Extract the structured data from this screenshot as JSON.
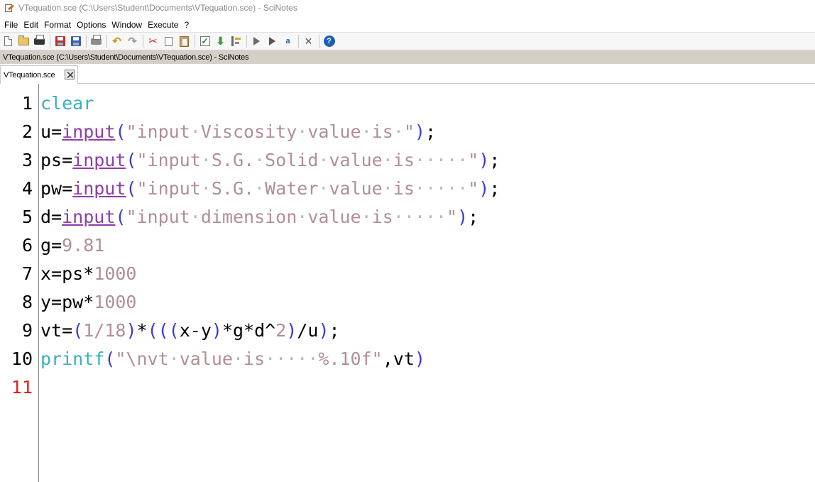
{
  "window": {
    "title": "VTequation.sce (C:\\Users\\Student\\Documents\\VTequation.sce) - SciNotes"
  },
  "menu": {
    "items": [
      "File",
      "Edit",
      "Format",
      "Options",
      "Window",
      "Execute",
      "?"
    ]
  },
  "toolbar": {
    "icons": [
      "new-file-icon",
      "open-folder-icon",
      "open-file-icon",
      "save-icon",
      "save-as-icon",
      "print-icon",
      "undo-icon",
      "redo-icon",
      "cut-icon",
      "copy-icon",
      "paste-icon",
      "check-icon",
      "load-into-scilab-icon",
      "execute-icon",
      "run-icon",
      "run-to-cursor-icon",
      "abc-icon",
      "tools-icon",
      "help-icon"
    ]
  },
  "pathbar": {
    "text": "VTequation.sce (C:\\Users\\Student\\Documents\\VTequation.sce) - SciNotes"
  },
  "tabs": [
    {
      "label": "VTequation.sce"
    }
  ],
  "editor": {
    "current_line": 11,
    "line_numbers": [
      "1",
      "2",
      "3",
      "4",
      "5",
      "6",
      "7",
      "8",
      "9",
      "10",
      "11"
    ],
    "lines": [
      [
        {
          "t": "clear",
          "c": "kw"
        }
      ],
      [
        {
          "t": "u=",
          "c": "op"
        },
        {
          "t": "input",
          "c": "fn"
        },
        {
          "t": "(",
          "c": "par"
        },
        {
          "t": "\"input",
          "c": "str"
        },
        {
          "t": "·",
          "c": "dot"
        },
        {
          "t": "Viscosity",
          "c": "str"
        },
        {
          "t": "·",
          "c": "dot"
        },
        {
          "t": "value",
          "c": "str"
        },
        {
          "t": "·",
          "c": "dot"
        },
        {
          "t": "is",
          "c": "str"
        },
        {
          "t": "·",
          "c": "dot"
        },
        {
          "t": "\"",
          "c": "str"
        },
        {
          "t": ")",
          "c": "par"
        },
        {
          "t": ";",
          "c": "op"
        }
      ],
      [
        {
          "t": "ps=",
          "c": "op"
        },
        {
          "t": "input",
          "c": "fn"
        },
        {
          "t": "(",
          "c": "par"
        },
        {
          "t": "\"input",
          "c": "str"
        },
        {
          "t": "·",
          "c": "dot"
        },
        {
          "t": "S.G.",
          "c": "str"
        },
        {
          "t": "·",
          "c": "dot"
        },
        {
          "t": "Solid",
          "c": "str"
        },
        {
          "t": "·",
          "c": "dot"
        },
        {
          "t": "value",
          "c": "str"
        },
        {
          "t": "·",
          "c": "dot"
        },
        {
          "t": "is",
          "c": "str"
        },
        {
          "t": "·····",
          "c": "dot"
        },
        {
          "t": "\"",
          "c": "str"
        },
        {
          "t": ")",
          "c": "par"
        },
        {
          "t": ";",
          "c": "op"
        }
      ],
      [
        {
          "t": "pw=",
          "c": "op"
        },
        {
          "t": "input",
          "c": "fn"
        },
        {
          "t": "(",
          "c": "par"
        },
        {
          "t": "\"input",
          "c": "str"
        },
        {
          "t": "·",
          "c": "dot"
        },
        {
          "t": "S.G.",
          "c": "str"
        },
        {
          "t": "·",
          "c": "dot"
        },
        {
          "t": "Water",
          "c": "str"
        },
        {
          "t": "·",
          "c": "dot"
        },
        {
          "t": "value",
          "c": "str"
        },
        {
          "t": "·",
          "c": "dot"
        },
        {
          "t": "is",
          "c": "str"
        },
        {
          "t": "·····",
          "c": "dot"
        },
        {
          "t": "\"",
          "c": "str"
        },
        {
          "t": ")",
          "c": "par"
        },
        {
          "t": ";",
          "c": "op"
        }
      ],
      [
        {
          "t": "d=",
          "c": "op"
        },
        {
          "t": "input",
          "c": "fn"
        },
        {
          "t": "(",
          "c": "par"
        },
        {
          "t": "\"input",
          "c": "str"
        },
        {
          "t": "·",
          "c": "dot"
        },
        {
          "t": "dimension",
          "c": "str"
        },
        {
          "t": "·",
          "c": "dot"
        },
        {
          "t": "value",
          "c": "str"
        },
        {
          "t": "·",
          "c": "dot"
        },
        {
          "t": "is",
          "c": "str"
        },
        {
          "t": "·····",
          "c": "dot"
        },
        {
          "t": "\"",
          "c": "str"
        },
        {
          "t": ")",
          "c": "par"
        },
        {
          "t": ";",
          "c": "op"
        }
      ],
      [
        {
          "t": "g=",
          "c": "op"
        },
        {
          "t": "9.81",
          "c": "num"
        }
      ],
      [
        {
          "t": "x=ps",
          "c": "op"
        },
        {
          "t": "*",
          "c": "op"
        },
        {
          "t": "1000",
          "c": "num"
        }
      ],
      [
        {
          "t": "y=pw",
          "c": "op"
        },
        {
          "t": "*",
          "c": "op"
        },
        {
          "t": "1000",
          "c": "num"
        }
      ],
      [
        {
          "t": "vt=",
          "c": "op"
        },
        {
          "t": "(",
          "c": "par"
        },
        {
          "t": "1/18",
          "c": "num"
        },
        {
          "t": ")",
          "c": "par"
        },
        {
          "t": "*",
          "c": "op"
        },
        {
          "t": "(((",
          "c": "par"
        },
        {
          "t": "x-y",
          "c": "op"
        },
        {
          "t": ")",
          "c": "par"
        },
        {
          "t": "*g*d^",
          "c": "op"
        },
        {
          "t": "2",
          "c": "num"
        },
        {
          "t": ")",
          "c": "par"
        },
        {
          "t": "/u",
          "c": "op"
        },
        {
          "t": ")",
          "c": "par"
        },
        {
          "t": ";",
          "c": "op"
        }
      ],
      [
        {
          "t": "printf",
          "c": "kw"
        },
        {
          "t": "(",
          "c": "par"
        },
        {
          "t": "\"\\nvt",
          "c": "str"
        },
        {
          "t": "·",
          "c": "dot"
        },
        {
          "t": "value",
          "c": "str"
        },
        {
          "t": "·",
          "c": "dot"
        },
        {
          "t": "is",
          "c": "str"
        },
        {
          "t": "·····",
          "c": "dot"
        },
        {
          "t": "%.10f\"",
          "c": "str"
        },
        {
          "t": ",vt",
          "c": "op"
        },
        {
          "t": ")",
          "c": "par"
        }
      ],
      []
    ]
  },
  "colors": {
    "keyword": "#3ab0b8",
    "function": "#8e3da8",
    "string": "#b08f96",
    "paren": "#3a3ad4",
    "current_line_number": "#e02020"
  }
}
